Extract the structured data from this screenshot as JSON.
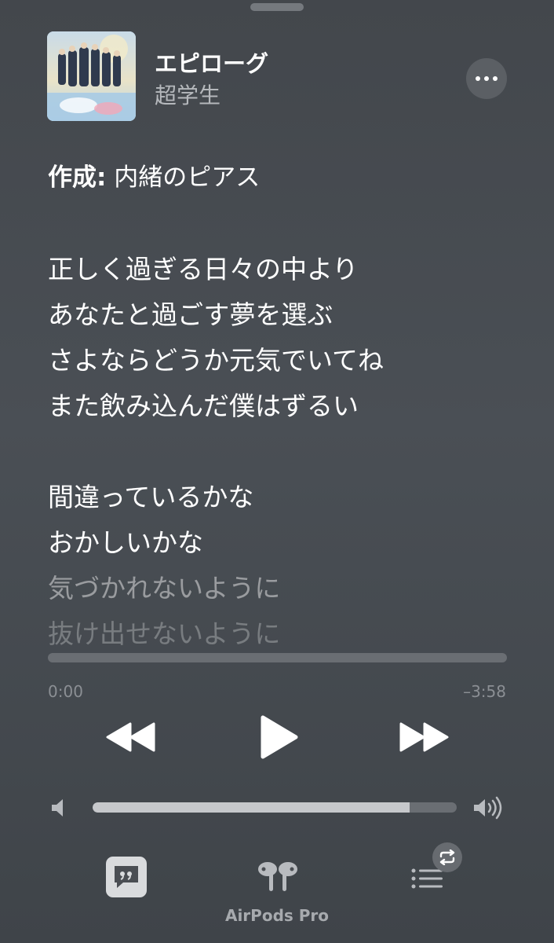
{
  "now_playing": {
    "title": "エピローグ",
    "artist": "超学生"
  },
  "lyrics": {
    "credit_label": "作成:",
    "credit_value": "内緒のピアス",
    "lines": [
      "正しく過ぎる日々の中より",
      "あなたと過ごす夢を選ぶ",
      "さよならどうか元気でいてね",
      "また飲み込んだ僕はずるい",
      "間違っているかな",
      "おかしいかな",
      "気づかれないように",
      "抜け出せないように"
    ]
  },
  "playback": {
    "elapsed": "0:00",
    "remaining": "–3:58",
    "progress_fraction": 0.0
  },
  "volume": {
    "level_fraction": 0.87
  },
  "output_device": {
    "label": "AirPods Pro"
  },
  "icons": {
    "more": "ellipsis-icon",
    "rewind": "rewind-icon",
    "play": "play-icon",
    "forward": "fast-forward-icon",
    "volume_low": "speaker-low-icon",
    "volume_high": "speaker-high-icon",
    "lyrics": "lyrics-quote-icon",
    "airplay": "airpods-icon",
    "queue": "queue-list-icon",
    "repeat": "repeat-icon"
  }
}
